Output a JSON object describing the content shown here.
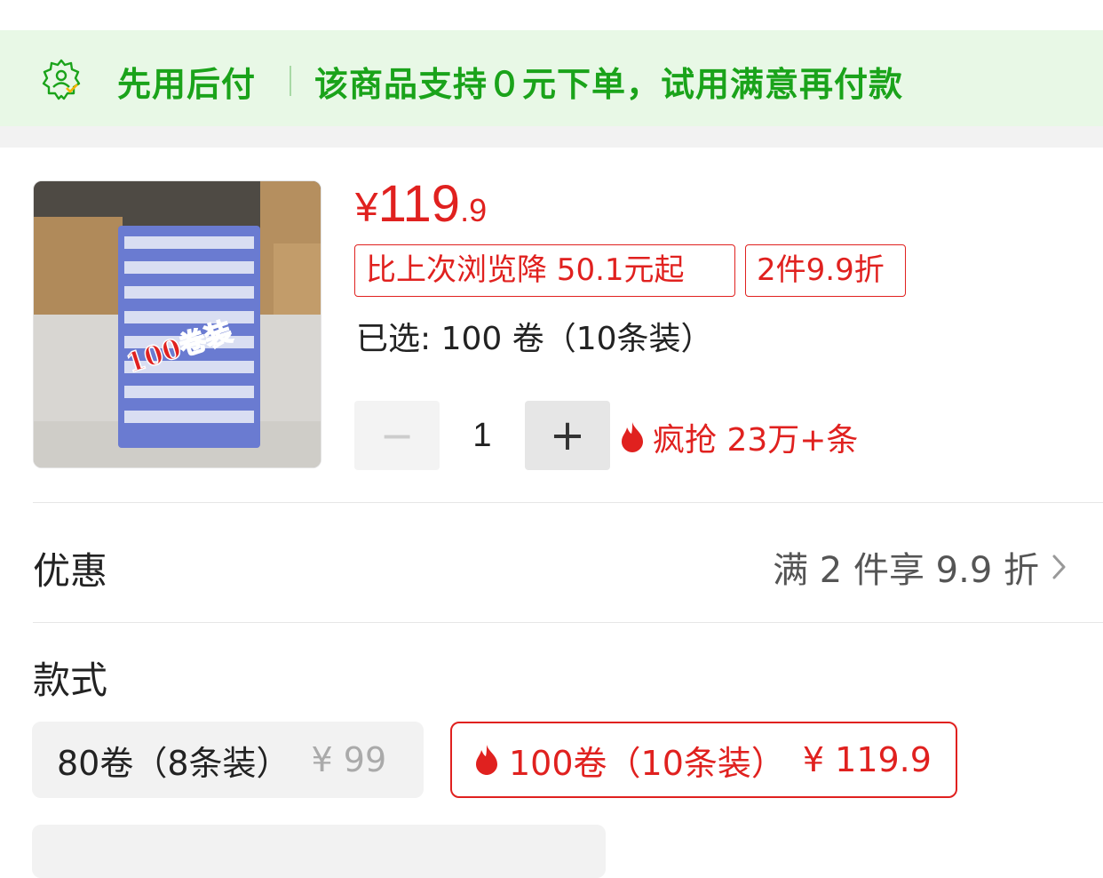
{
  "banner": {
    "title": "先用后付",
    "text": "该商品支持０元下单，试用满意再付款",
    "icon": "shield-user-icon"
  },
  "product": {
    "image_label": "100卷装",
    "price": {
      "currency": "¥",
      "integer": "119",
      "decimal": ".9"
    },
    "tags": [
      "比上次浏览降 50.1元起",
      "2件9.9折"
    ],
    "selected": "已选: 100 卷（10条装）",
    "quantity": "1",
    "minus_symbol": "−",
    "plus_symbol": "+",
    "hot_text": "疯抢 23万+条"
  },
  "promo": {
    "label": "优惠",
    "value": "满 2 件享 9.9 折"
  },
  "style": {
    "label": "款式",
    "options": [
      {
        "name": "80卷（8条装）",
        "price": "¥ 99",
        "selected": false
      },
      {
        "name": "100卷（10条装）",
        "price": "¥ 119.9",
        "selected": true
      }
    ]
  },
  "colors": {
    "accent_red": "#e0211f",
    "green": "#1aa31a",
    "banner_bg": "#e8f8e6"
  }
}
